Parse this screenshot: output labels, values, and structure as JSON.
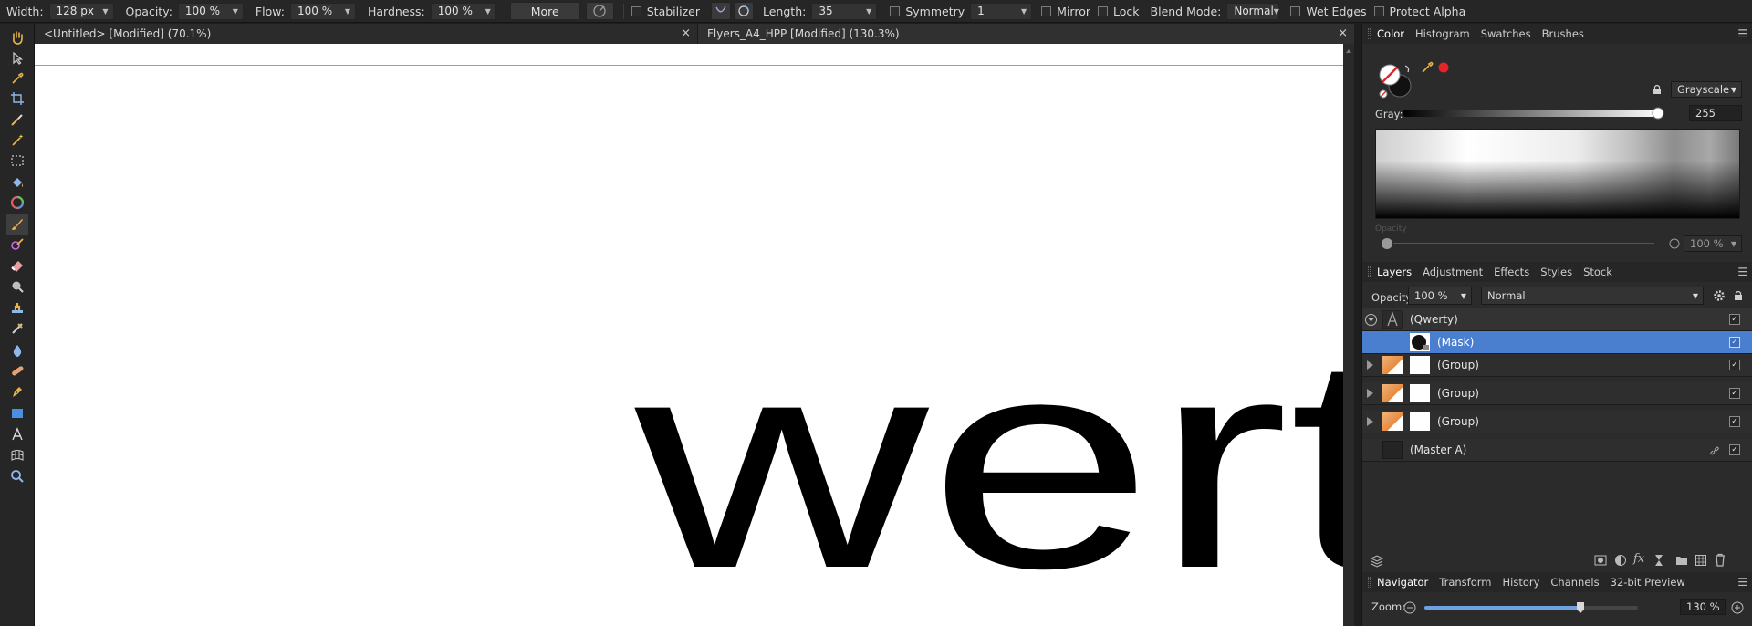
{
  "toolbar": {
    "width_label": "Width:",
    "width_value": "128 px",
    "opacity_label": "Opacity:",
    "opacity_value": "100 %",
    "flow_label": "Flow:",
    "flow_value": "100 %",
    "hardness_label": "Hardness:",
    "hardness_value": "100 %",
    "more_label": "More",
    "stabilizer_label": "Stabilizer",
    "length_label": "Length:",
    "length_value": "35",
    "symmetry_label": "Symmetry",
    "symmetry_value": "1",
    "mirror_label": "Mirror",
    "lock_label": "Lock",
    "blend_label": "Blend Mode:",
    "blend_value": "Normal",
    "wet_edges_label": "Wet Edges",
    "protect_alpha_label": "Protect Alpha"
  },
  "tabs": [
    {
      "label": "<Untitled> [Modified] (70.1%)",
      "close": "×"
    },
    {
      "label": "Flyers_A4_HPP [Modified] (130.3%)",
      "close": "×"
    }
  ],
  "canvas": {
    "text": "wert"
  },
  "color_panel": {
    "tabs": [
      "Color",
      "Histogram",
      "Swatches",
      "Brushes"
    ],
    "mode": "Grayscale",
    "gray_label": "Gray:",
    "gray_value": "255",
    "opacity_label": "Opacity",
    "opacity_value": "100 %"
  },
  "layers_panel": {
    "tabs": [
      "Layers",
      "Adjustment",
      "Effects",
      "Styles",
      "Stock"
    ],
    "opacity_label": "Opacity:",
    "opacity_value": "100 %",
    "blend_value": "Normal",
    "layers": [
      {
        "name": "(Qwerty)"
      },
      {
        "name": "(Mask)"
      },
      {
        "name": "(Group)"
      },
      {
        "name": "(Group)"
      },
      {
        "name": "(Group)"
      },
      {
        "name": "(Master A)"
      }
    ]
  },
  "navigator_panel": {
    "tabs": [
      "Navigator",
      "Transform",
      "History",
      "Channels",
      "32-bit Preview"
    ],
    "zoom_label": "Zoom:",
    "zoom_value": "130 %",
    "zoom_fraction": 0.73
  },
  "colors": {
    "selection": "#4a7fd0",
    "guide": "#58b4d8",
    "accent_red": "#e0262b"
  }
}
